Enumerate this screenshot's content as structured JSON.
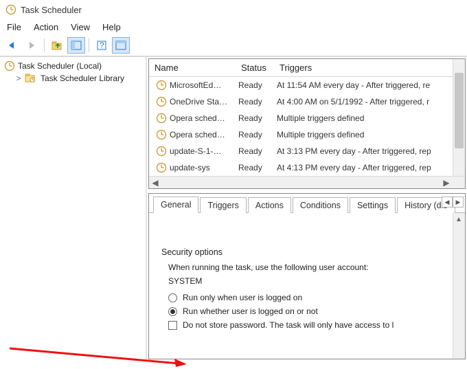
{
  "app": {
    "title": "Task Scheduler"
  },
  "menu": {
    "file": "File",
    "action": "Action",
    "view": "View",
    "help": "Help"
  },
  "tree": {
    "root": "Task Scheduler (Local)",
    "library": "Task Scheduler Library"
  },
  "list": {
    "headers": {
      "name": "Name",
      "status": "Status",
      "triggers": "Triggers"
    },
    "rows": [
      {
        "name": "MicrosoftEd…",
        "status": "Ready",
        "triggers": "At 11:54 AM every day - After triggered, re"
      },
      {
        "name": "OneDrive Sta…",
        "status": "Ready",
        "triggers": "At 4:00 AM on 5/1/1992 - After triggered, r"
      },
      {
        "name": "Opera sched…",
        "status": "Ready",
        "triggers": "Multiple triggers defined"
      },
      {
        "name": "Opera sched…",
        "status": "Ready",
        "triggers": "Multiple triggers defined"
      },
      {
        "name": "update-S-1-…",
        "status": "Ready",
        "triggers": "At 3:13 PM every day - After triggered, rep"
      },
      {
        "name": "update-sys",
        "status": "Ready",
        "triggers": "At 4:13 PM every day - After triggered, rep"
      }
    ]
  },
  "tabs": {
    "general": "General",
    "triggers": "Triggers",
    "actions": "Actions",
    "conditions": "Conditions",
    "settings": "Settings",
    "history": "History (dis"
  },
  "security": {
    "group_title": "Security options",
    "account_line": "When running the task, use the following user account:",
    "account_value": "SYSTEM",
    "radio_logged_on": "Run only when user is logged on",
    "radio_whether": "Run whether user is logged on or not",
    "chk_no_store": "Do not store password.  The task will only have access to l"
  }
}
